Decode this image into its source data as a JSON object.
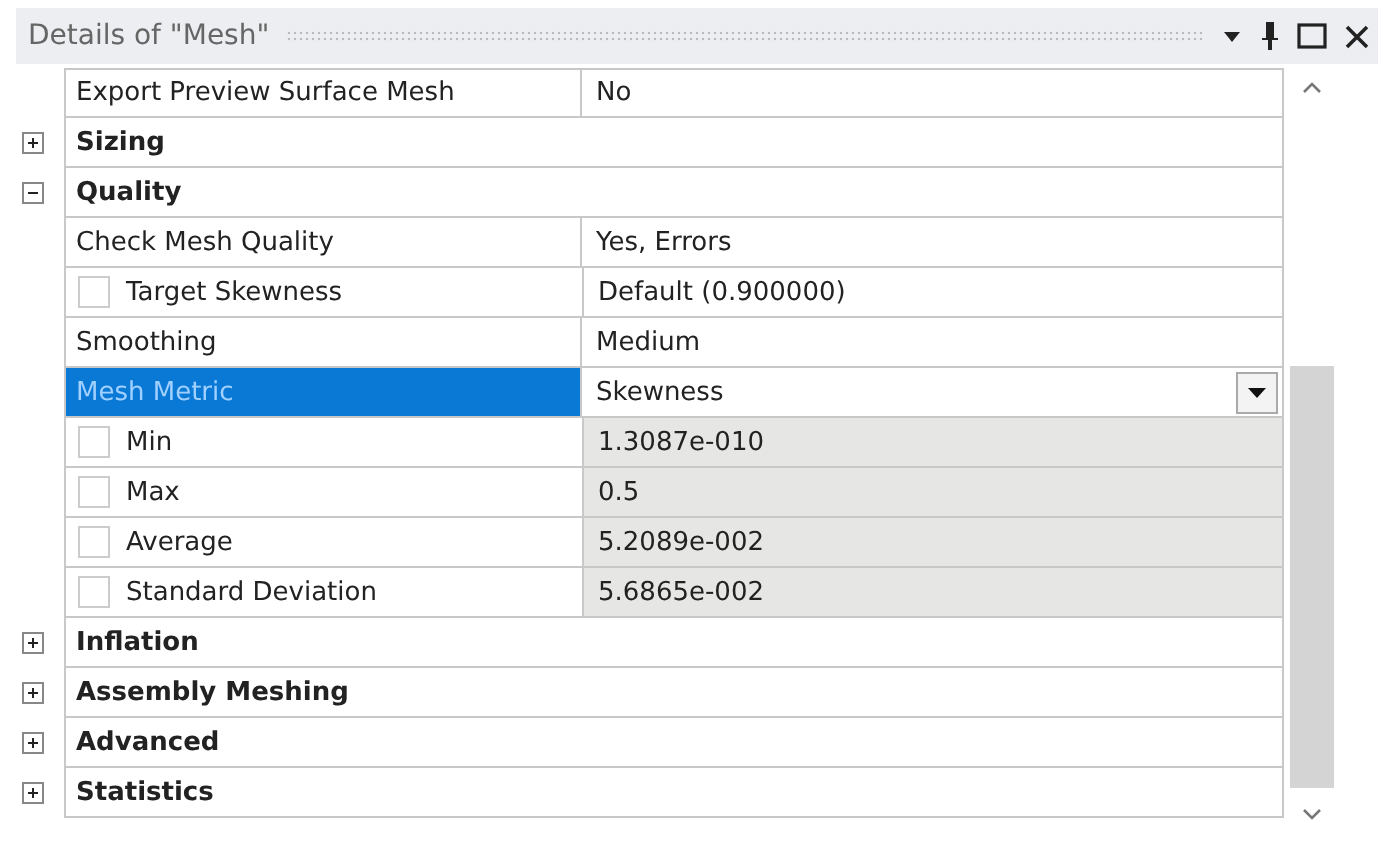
{
  "panel": {
    "title": "Details of \"Mesh\""
  },
  "rows": [
    {
      "kind": "property",
      "name": "Export Preview Surface Mesh",
      "value": "No",
      "selected": false,
      "read_only": false
    },
    {
      "kind": "group",
      "name": "Sizing",
      "expanded": false
    },
    {
      "kind": "group",
      "name": "Quality",
      "expanded": true
    },
    {
      "kind": "property",
      "name": "Check Mesh Quality",
      "value": "Yes, Errors",
      "selected": false,
      "read_only": false
    },
    {
      "kind": "parameter",
      "name": "Target Skewness",
      "value": "Default (0.900000)",
      "checked": false,
      "selected": false,
      "read_only": false
    },
    {
      "kind": "property",
      "name": "Smoothing",
      "value": "Medium",
      "selected": false,
      "read_only": false
    },
    {
      "kind": "dropdown",
      "name": "Mesh Metric",
      "value": "Skewness",
      "selected": true,
      "read_only": false
    },
    {
      "kind": "parameter",
      "name": "Min",
      "value": "1.3087e-010",
      "checked": false,
      "selected": false,
      "read_only": true
    },
    {
      "kind": "parameter",
      "name": "Max",
      "value": "0.5",
      "checked": false,
      "selected": false,
      "read_only": true
    },
    {
      "kind": "parameter",
      "name": "Average",
      "value": "5.2089e-002",
      "checked": false,
      "selected": false,
      "read_only": true
    },
    {
      "kind": "parameter",
      "name": "Standard Deviation",
      "value": "5.6865e-002",
      "checked": false,
      "selected": false,
      "read_only": true
    },
    {
      "kind": "group",
      "name": "Inflation",
      "expanded": false
    },
    {
      "kind": "group",
      "name": "Assembly Meshing",
      "expanded": false
    },
    {
      "kind": "group",
      "name": "Advanced",
      "expanded": false
    },
    {
      "kind": "group",
      "name": "Statistics",
      "expanded": false
    }
  ]
}
